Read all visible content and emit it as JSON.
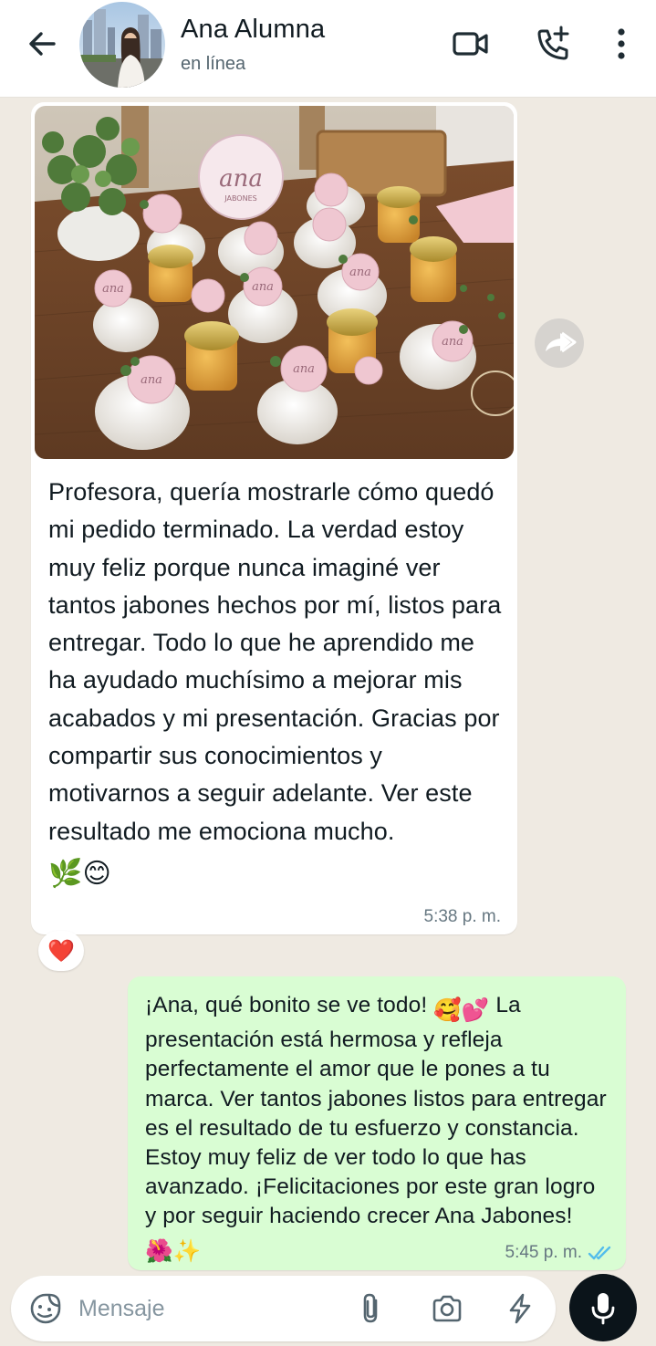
{
  "header": {
    "contact_name": "Ana Alumna",
    "status": "en línea",
    "icons": [
      "back-arrow-icon",
      "video-call-icon",
      "add-call-icon",
      "more-vertical-icon"
    ]
  },
  "messages": [
    {
      "direction": "incoming",
      "has_photo": true,
      "photo_label": "Ana JABONES",
      "text": "Profesora, quería mostrarle cómo quedó mi pedido terminado. La verdad estoy muy feliz porque nunca imaginé ver tantos jabones hechos por mí, listos para entregar. Todo lo que he aprendido me ha ayudado muchísimo a mejorar mis acabados y mi presentación. Gracias por compartir sus conocimientos y motivarnos a seguir adelante. Ver este resultado me emociona mucho.",
      "emojis": "🌿😊",
      "time": "5:38 p. m.",
      "reaction": "❤️"
    },
    {
      "direction": "outgoing",
      "text_part1": "¡Ana, qué bonito se ve todo! ",
      "emojis_1": "🥰💕",
      "text_part2": " La presentación está hermosa y refleja perfectamente el amor que le pones a tu marca. Ver tantos jabones listos para entregar es el resultado de tu esfuerzo y constancia. Estoy muy feliz de ver todo lo que has avanzado. ¡Felicitaciones por este gran logro y por seguir haciendo crecer Ana Jabones! ",
      "emojis_2": "🌺✨",
      "time": "5:45 p. m.",
      "read_status": "read"
    }
  ],
  "input": {
    "placeholder": "Mensaje",
    "icons": [
      "emoji-sticker-icon",
      "paperclip-icon",
      "camera-icon",
      "lightning-icon",
      "microphone-icon"
    ]
  },
  "colors": {
    "chat_bg": "#efeae2",
    "incoming_bubble": "#ffffff",
    "outgoing_bubble": "#d9fdd3",
    "read_ticks": "#53bdeb",
    "mic_button": "#0b141a"
  }
}
